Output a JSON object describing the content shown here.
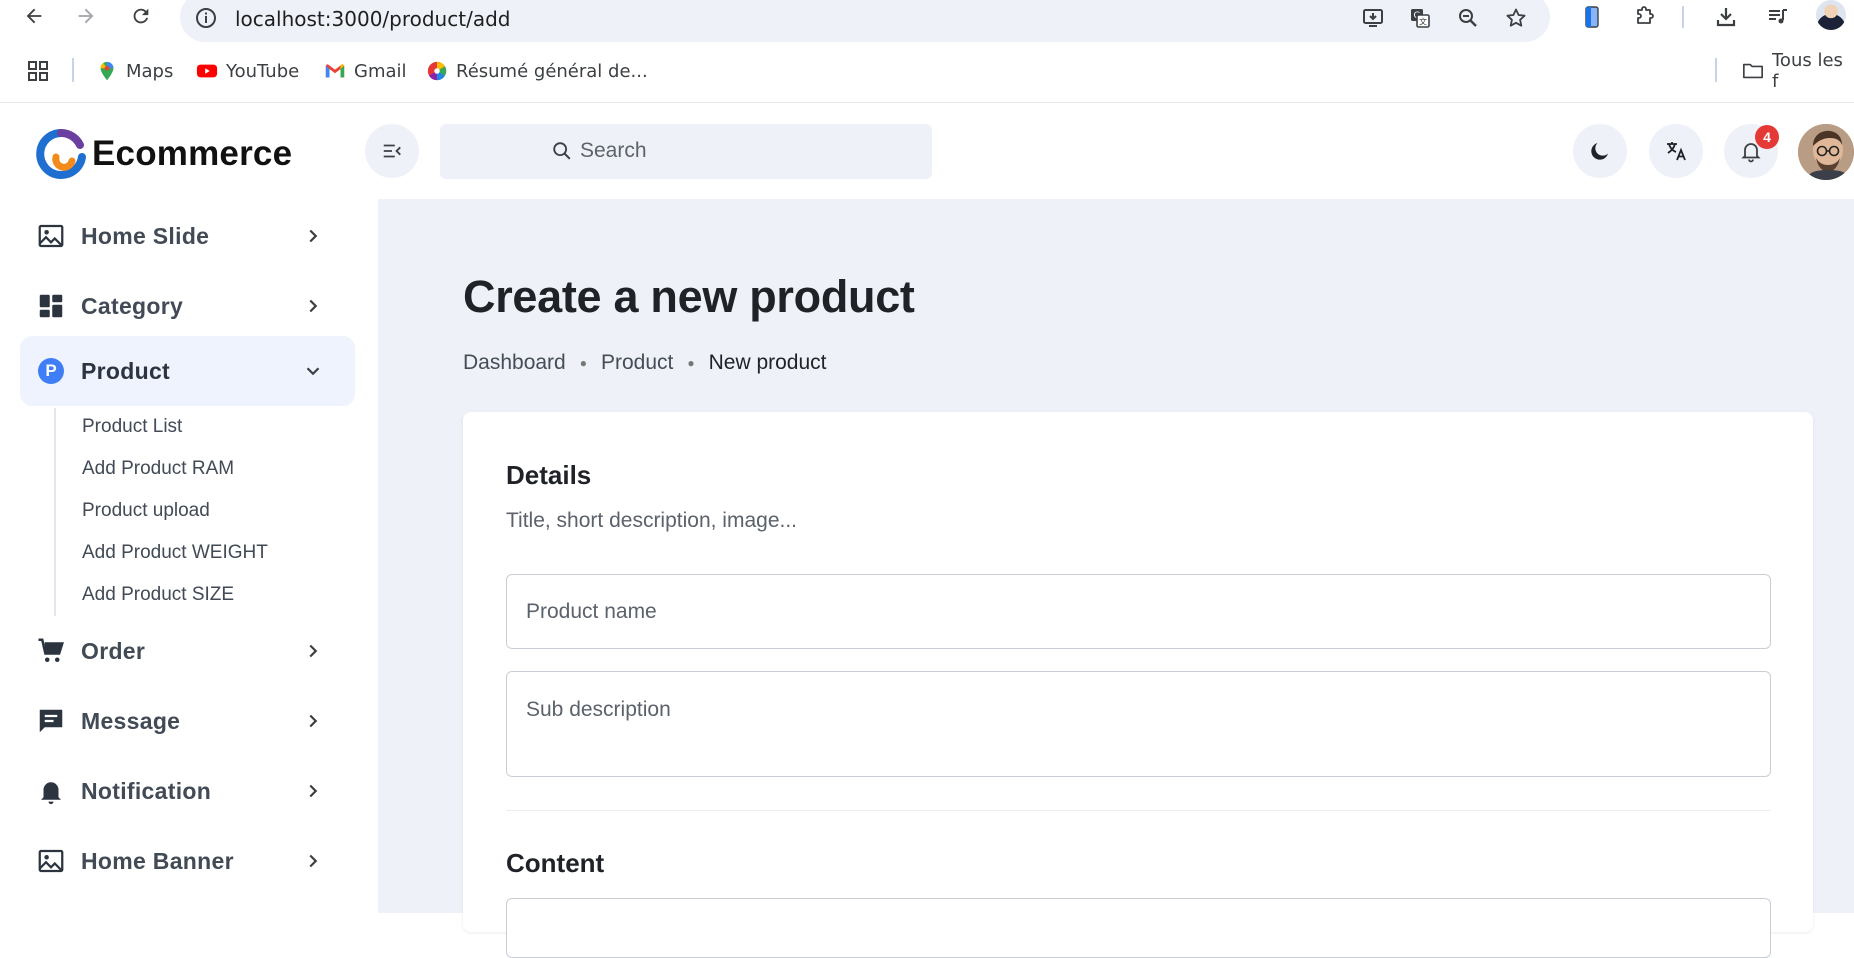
{
  "browser": {
    "url": "localhost:3000/product/add",
    "bookmarks": [
      {
        "label": "Maps",
        "icon": "maps-icon"
      },
      {
        "label": "YouTube",
        "icon": "youtube-icon"
      },
      {
        "label": "Gmail",
        "icon": "gmail-icon"
      },
      {
        "label": "Résumé général de...",
        "icon": "color-wheel-icon"
      }
    ],
    "all_bookmarks_label": "Tous les f"
  },
  "header": {
    "logo_text": "Ecommerce",
    "search_placeholder": "Search",
    "notification_count": "4"
  },
  "sidebar": {
    "items": [
      {
        "label": "Home Slide",
        "icon": "image-icon"
      },
      {
        "label": "Category",
        "icon": "dashboard-grid-icon"
      },
      {
        "label": "Product",
        "icon": "product-p-icon",
        "icon_letter": "P",
        "expanded": true
      },
      {
        "label": "Order",
        "icon": "cart-icon"
      },
      {
        "label": "Message",
        "icon": "message-icon"
      },
      {
        "label": "Notification",
        "icon": "bell-icon"
      },
      {
        "label": "Home Banner",
        "icon": "image-icon"
      }
    ],
    "product_subitems": [
      "Product List",
      "Add Product RAM",
      "Product upload",
      "Add Product WEIGHT",
      "Add Product SIZE"
    ]
  },
  "main": {
    "title": "Create a new product",
    "breadcrumb": [
      "Dashboard",
      "Product",
      "New product"
    ],
    "details": {
      "title": "Details",
      "subtitle": "Title, short description, image...",
      "name_placeholder": "Product name",
      "description_placeholder": "Sub description"
    },
    "content": {
      "title": "Content"
    }
  },
  "colors": {
    "accent": "#3f7ef6",
    "badge": "#e53935",
    "main_bg": "#eef1f7",
    "active_item_bg": "#eef3fe"
  }
}
